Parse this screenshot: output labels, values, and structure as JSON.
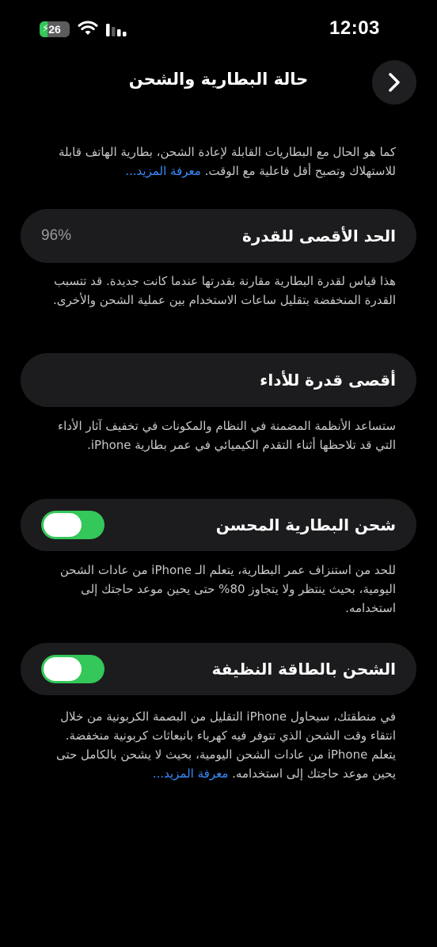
{
  "status_bar": {
    "time": "12:03",
    "battery_level": "26",
    "battery_fraction": 0.26
  },
  "nav": {
    "title": "حالة البطارية والشحن",
    "back_icon": "chevron-right-icon"
  },
  "intro": {
    "text": "كما هو الحال مع البطاريات القابلة لإعادة الشحن، بطارية الهاتف قابلة للاستهلاك وتصبح أقل فاعلية مع الوقت. ",
    "link": "معرفة المزيد..."
  },
  "max_capacity": {
    "label": "الحد الأقصى للقدرة",
    "value": "96%",
    "footnote": "هذا قياس لقدرة البطارية مقارنة بقدرتها عندما كانت جديدة. قد تتسبب القدرة المنخفضة بتقليل ساعات الاستخدام بين عملية الشحن والأخرى."
  },
  "peak_performance": {
    "label": "أقصى قدرة للأداء",
    "footnote": "ستساعد الأنظمة المضمنة في النظام والمكونات في تخفيف آثار الأداء التي قد تلاحظها أثناء التقدم الكيميائي في عمر بطارية iPhone."
  },
  "optimized_charging": {
    "label": "شحن البطارية المحسن",
    "enabled": true,
    "footnote": "للحد من استنزاف عمر البطارية، يتعلم الـ iPhone من عادات الشحن اليومية، بحيث ينتظر ولا يتجاوز 80% حتى يحين موعد حاجتك إلى استخدامه."
  },
  "clean_energy": {
    "label": "الشحن بالطاقة النظيفة",
    "enabled": true,
    "footnote": "في منطقتك، سيحاول iPhone التقليل من البصمة الكربونية من خلال انتقاء وقت الشحن الذي تتوفر فيه كهرباء بانبعاثات كربونية منخفضة. يتعلم iPhone من عادات الشحن اليومية، بحيث لا يشحن بالكامل حتى يحين موعد حاجتك إلى استخدامه. ",
    "link": "معرفة المزيد..."
  },
  "colors": {
    "background": "#000000",
    "card": "#1c1c1e",
    "toggle_on": "#34c759",
    "link": "#3b8cff",
    "secondary_text": "#c9c9cc"
  }
}
